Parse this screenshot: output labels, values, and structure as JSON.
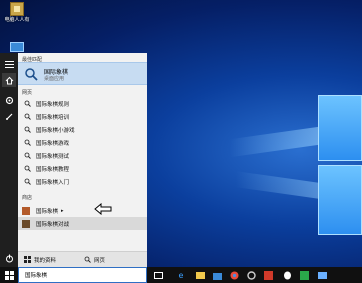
{
  "desktop": {
    "icon_label": "电脑人人有"
  },
  "search": {
    "best_match_header": "最佳匹配",
    "best_match_title": "国际象棋",
    "best_match_sub": "桌面应用",
    "web_header": "网页",
    "web_results": [
      "国际象棋规则",
      "国际象棋培训",
      "国际象棋小游戏",
      "国际象棋游戏",
      "国际象棋测试",
      "国际象棋教程",
      "国际象棋入门"
    ],
    "store_header": "商店",
    "store_results": [
      "国际象棋",
      "国际象棋对战"
    ],
    "store_expand_glyph": "▸",
    "my_stuff": "我的资料",
    "web_button": "网页",
    "query": "国际象棋"
  },
  "colors": {
    "accent": "#2f6fc4",
    "panel_bg": "#f2f2f2",
    "selected_bg": "#c7dcf2"
  },
  "icons": {
    "rail": [
      "hamburger-icon",
      "home-icon",
      "settings-icon",
      "feedback-icon",
      "power-icon"
    ],
    "taskbar": [
      "windows-icon",
      "edge-icon",
      "file-explorer-icon",
      "store-icon",
      "chrome-icon",
      "settings-icon",
      "app-icon",
      "qq-icon",
      "media-icon",
      "folder-icon"
    ]
  }
}
